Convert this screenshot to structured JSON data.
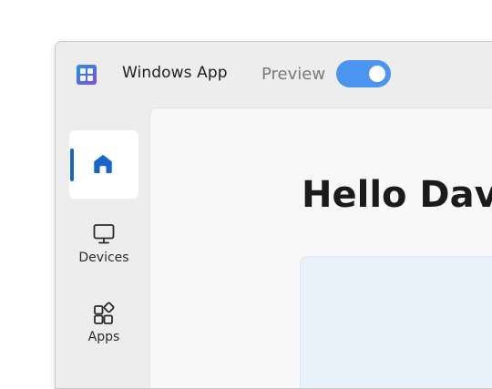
{
  "app": {
    "title": "Windows App",
    "logo_icon": "windows-app-logo-icon"
  },
  "preview": {
    "label": "Preview",
    "enabled": true,
    "toggle_color": "#4c95ee"
  },
  "sidebar": {
    "items": [
      {
        "id": "home",
        "label": "",
        "icon": "home-icon",
        "selected": true
      },
      {
        "id": "devices",
        "label": "Devices",
        "icon": "monitor-icon",
        "selected": false
      },
      {
        "id": "apps",
        "label": "Apps",
        "icon": "apps-grid-icon",
        "selected": false
      }
    ],
    "accent_color": "#1566c6"
  },
  "main": {
    "greeting": "Hello David"
  }
}
